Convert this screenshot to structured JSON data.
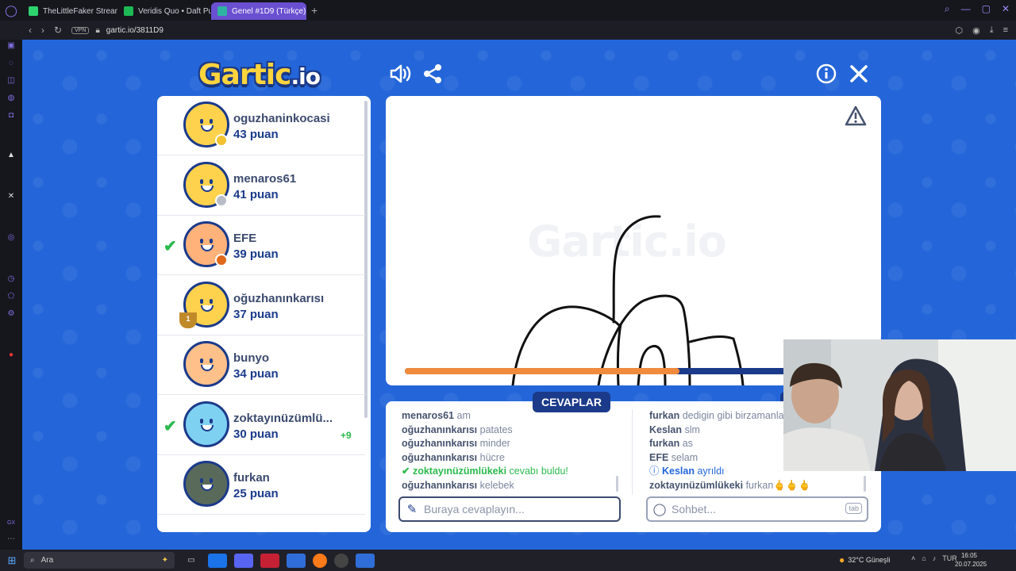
{
  "browser": {
    "tabs": [
      {
        "label": "TheLittleFaker Stream - W",
        "color": "#2dd36f"
      },
      {
        "label": "Veridis Quo • Daft Pu",
        "color": "#1db954"
      },
      {
        "label": "Genel #1D9 (Türkçe)",
        "color": "#2eb3a3"
      }
    ],
    "add_tab": "+",
    "vpn": "VPN",
    "url": "gartic.io/3811D9"
  },
  "game": {
    "logo_main": "Gartic",
    "logo_io": ".io",
    "canvas_watermark": "Gartic.io",
    "timer_progress": 0.595,
    "answers_label": "CEVAPLAR",
    "answer_placeholder": "Buraya cevaplayın...",
    "chat_placeholder": "Sohbet...",
    "tab_key": "tab"
  },
  "players": [
    {
      "name": "oguzhaninkocasi",
      "score": "43 puan",
      "dot": "#f2c230",
      "check": false,
      "trophy": ""
    },
    {
      "name": "menaros61",
      "score": "41 puan",
      "dot": "#b9bdc6",
      "check": false,
      "trophy": ""
    },
    {
      "name": "EFE",
      "score": "39 puan",
      "dot": "#e06a1b",
      "check": true,
      "trophy": ""
    },
    {
      "name": "oğuzhanınkarısı",
      "score": "37 puan",
      "dot": "",
      "check": false,
      "trophy": "1"
    },
    {
      "name": "bunyo",
      "score": "34 puan",
      "dot": "",
      "check": false,
      "trophy": ""
    },
    {
      "name": "zoktayınüzümlü...",
      "score": "30 puan",
      "dot": "",
      "check": true,
      "trophy": "",
      "bonus": "+9"
    },
    {
      "name": "furkan",
      "score": "25 puan",
      "dot": "",
      "check": false,
      "trophy": ""
    }
  ],
  "answers": [
    {
      "who": "menaros61",
      "text": "am"
    },
    {
      "who": "oğuzhanınkarısı",
      "text": "patates"
    },
    {
      "who": "oğuzhanınkarısı",
      "text": "minder"
    },
    {
      "who": "oğuzhanınkarısı",
      "text": "hücre"
    },
    {
      "who": "zoktayınüzümlükeki",
      "text": "cevabı buldu!",
      "found": true
    },
    {
      "who": "oğuzhanınkarısı",
      "text": "kelebek"
    }
  ],
  "chat": [
    {
      "who": "furkan",
      "text": "dedigin gibi birzamanlar"
    },
    {
      "who": "Keslan",
      "text": "slm"
    },
    {
      "who": "furkan",
      "text": "as"
    },
    {
      "who": "EFE",
      "text": "selam"
    },
    {
      "who": "Keslan",
      "text": "ayrıldı",
      "info": true
    },
    {
      "who": "zoktayınüzümlükeki",
      "text": "furkan🖕🖕🖕"
    }
  ],
  "taskbar": {
    "search": "Ara",
    "weather": "32°C  Güneşli",
    "lang": "TUR",
    "time": "16:05",
    "date": "20.07.2025"
  }
}
